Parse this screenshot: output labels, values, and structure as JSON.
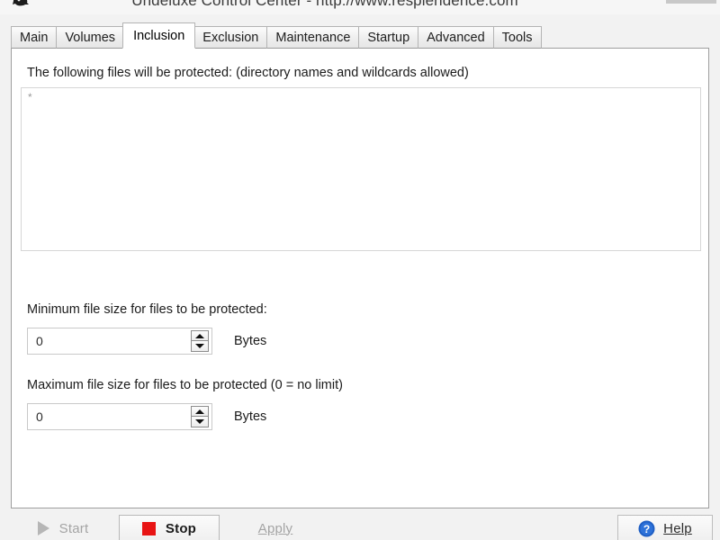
{
  "window": {
    "title": "Undeluxe Control Center - http://www.resplendence.com",
    "app_icon": "app-icon",
    "controls": {
      "minimize": "minimize-icon",
      "maximize": "maximize-icon",
      "close": "close-icon",
      "close_glyph": "✕"
    }
  },
  "tabs": [
    {
      "label": "Main",
      "selected": false
    },
    {
      "label": "Volumes",
      "selected": false
    },
    {
      "label": "Inclusion",
      "selected": true
    },
    {
      "label": "Exclusion",
      "selected": false
    },
    {
      "label": "Maintenance",
      "selected": false
    },
    {
      "label": "Startup",
      "selected": false
    },
    {
      "label": "Advanced",
      "selected": false
    },
    {
      "label": "Tools",
      "selected": false
    }
  ],
  "inclusion_page": {
    "files_label": "The following files will be protected:  (directory names and wildcards allowed)",
    "files_value": "*",
    "min_size_label": "Minimum file size for files to be protected:",
    "min_size_value": "0",
    "min_size_unit": "Bytes",
    "max_size_label": "Maximum file size for files to be protected (0 = no limit)",
    "max_size_value": "0",
    "max_size_unit": "Bytes",
    "spinner_up_icon": "triangle-up-icon",
    "spinner_down_icon": "triangle-down-icon"
  },
  "footer": {
    "start": {
      "label": "Start",
      "icon": "play-triangle-icon",
      "enabled": false
    },
    "stop": {
      "label": "Stop",
      "icon": "stop-square-icon",
      "enabled": true
    },
    "apply": {
      "label": "Apply",
      "enabled": false
    },
    "help": {
      "label": "Help",
      "icon": "question-circle-icon",
      "enabled": true
    }
  },
  "colors": {
    "stop_red": "#e81414",
    "help_blue": "#1f5fc4",
    "selected_tab_bg": "#ffffff",
    "window_bg": "#f2f2f2"
  }
}
